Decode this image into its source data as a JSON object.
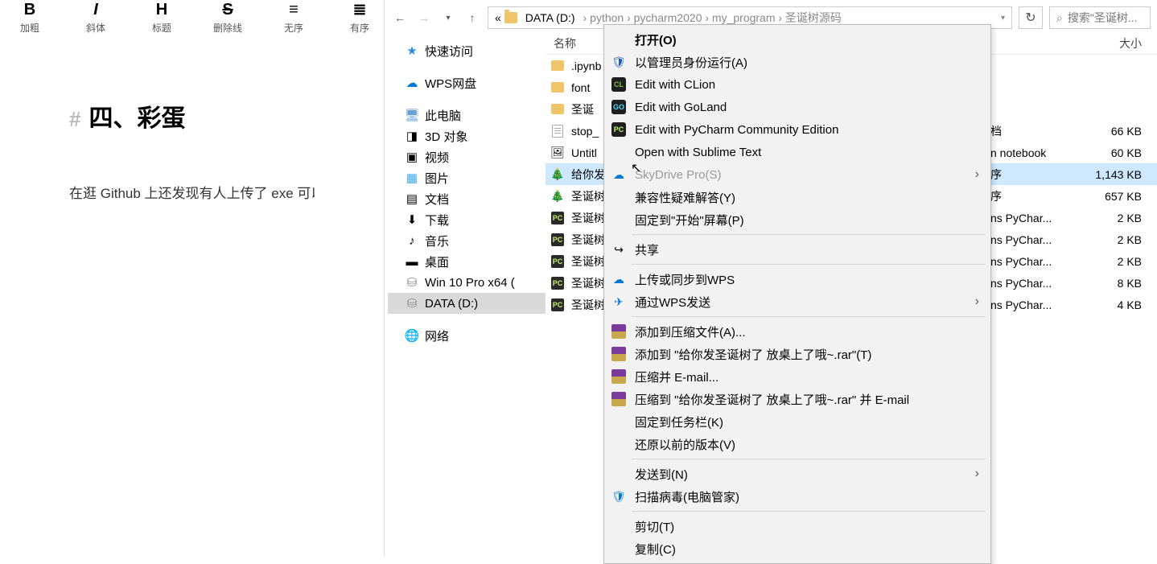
{
  "md": {
    "toolbar": [
      {
        "glyph": "B",
        "cls": "",
        "label": "加粗",
        "name": "bold-button"
      },
      {
        "glyph": "I",
        "cls": "ital",
        "label": "斜体",
        "name": "italic-button"
      },
      {
        "glyph": "H",
        "cls": "",
        "label": "标题",
        "name": "heading-button"
      },
      {
        "glyph": "S",
        "cls": "strike",
        "label": "删除线",
        "name": "strike-button"
      },
      {
        "glyph": "≡",
        "cls": "",
        "label": "无序",
        "name": "ul-button"
      },
      {
        "glyph": "≣",
        "cls": "",
        "label": "有序",
        "name": "ol-button"
      }
    ],
    "heading_hash": "#",
    "heading_text": "四、彩蛋",
    "paragraph": "在逛 Github 上还发现有人上传了 exe 可以"
  },
  "explorer": {
    "breadcrumb": {
      "label": "DATA (D:)",
      "tail": [
        "python",
        "pycharm2020",
        "my_program",
        "圣诞树源码"
      ],
      "lead": "«"
    },
    "search_placeholder": "搜索\"圣诞树...",
    "tree": [
      {
        "icon": "star",
        "label": "快速访问",
        "name": "quick-access"
      },
      {
        "sep": true
      },
      {
        "icon": "cloud",
        "label": "WPS网盘",
        "name": "wps-cloud"
      },
      {
        "sep": true
      },
      {
        "icon": "pc",
        "label": "此电脑",
        "name": "this-pc"
      },
      {
        "icon": "cube",
        "label": "3D 对象",
        "name": "3d-objects"
      },
      {
        "icon": "video",
        "label": "视频",
        "name": "videos"
      },
      {
        "icon": "pic",
        "label": "图片",
        "name": "pictures"
      },
      {
        "icon": "doc",
        "label": "文档",
        "name": "documents"
      },
      {
        "icon": "down",
        "label": "下载",
        "name": "downloads"
      },
      {
        "icon": "music",
        "label": "音乐",
        "name": "music"
      },
      {
        "icon": "desk",
        "label": "桌面",
        "name": "desktop"
      },
      {
        "icon": "drive",
        "label": "Win 10 Pro x64 (",
        "name": "drive-c"
      },
      {
        "icon": "drive",
        "label": "DATA (D:)",
        "name": "drive-d",
        "sel": true
      },
      {
        "sep": true
      },
      {
        "icon": "net",
        "label": "网络",
        "name": "network"
      }
    ],
    "headers": {
      "name": "名称",
      "type": "",
      "size": "大小"
    },
    "files": [
      {
        "icon": "fold",
        "name": ".ipynb",
        "type": "",
        "size": ""
      },
      {
        "icon": "fold",
        "name": "font",
        "type": "",
        "size": ""
      },
      {
        "icon": "fold",
        "name": "圣诞",
        "type": "",
        "size": ""
      },
      {
        "icon": "txt",
        "name": "stop_",
        "type": "档",
        "size": "66 KB"
      },
      {
        "icon": "img",
        "name": "Untitl",
        "type": "n notebook",
        "size": "60 KB"
      },
      {
        "icon": "tree",
        "name": "给你发",
        "type": "序",
        "size": "1,143 KB",
        "sel": true
      },
      {
        "icon": "tree",
        "name": "圣诞树",
        "type": "序",
        "size": "657 KB"
      },
      {
        "icon": "py",
        "name": "圣诞树",
        "type": "ns PyChar...",
        "size": "2 KB"
      },
      {
        "icon": "py",
        "name": "圣诞树",
        "type": "ns PyChar...",
        "size": "2 KB"
      },
      {
        "icon": "py",
        "name": "圣诞树",
        "type": "ns PyChar...",
        "size": "2 KB"
      },
      {
        "icon": "py",
        "name": "圣诞树",
        "type": "ns PyChar...",
        "size": "8 KB"
      },
      {
        "icon": "py",
        "name": "圣诞树",
        "type": "ns PyChar...",
        "size": "4 KB"
      }
    ]
  },
  "ctx": [
    {
      "label": "打开(O)",
      "bold": true
    },
    {
      "label": "以管理员身份运行(A)",
      "icon": "shield"
    },
    {
      "label": "Edit with CLion",
      "icon": "cl"
    },
    {
      "label": "Edit with GoLand",
      "icon": "go"
    },
    {
      "label": "Edit with PyCharm Community Edition",
      "icon": "pc"
    },
    {
      "label": "Open with Sublime Text"
    },
    {
      "label": "SkyDrive Pro(S)",
      "icon": "cloud",
      "arrow": true,
      "disabled": true
    },
    {
      "label": "兼容性疑难解答(Y)"
    },
    {
      "label": "固定到\"开始\"屏幕(P)"
    },
    {
      "sep": true
    },
    {
      "label": "共享",
      "icon": "share"
    },
    {
      "sep": true
    },
    {
      "label": "上传或同步到WPS",
      "icon": "cloud2"
    },
    {
      "label": "通过WPS发送",
      "icon": "send",
      "arrow": true
    },
    {
      "sep": true
    },
    {
      "label": "添加到压缩文件(A)...",
      "icon": "rar"
    },
    {
      "label": "添加到 \"给你发圣诞树了 放桌上了哦~.rar\"(T)",
      "icon": "rar"
    },
    {
      "label": "压缩并 E-mail...",
      "icon": "rar"
    },
    {
      "label": "压缩到 \"给你发圣诞树了 放桌上了哦~.rar\" 并 E-mail",
      "icon": "rar"
    },
    {
      "label": "固定到任务栏(K)"
    },
    {
      "label": "还原以前的版本(V)"
    },
    {
      "sep": true
    },
    {
      "label": "发送到(N)",
      "arrow": true
    },
    {
      "label": "扫描病毒(电脑管家)",
      "icon": "scan"
    },
    {
      "sep": true
    },
    {
      "label": "剪切(T)"
    },
    {
      "label": "复制(C)"
    }
  ]
}
